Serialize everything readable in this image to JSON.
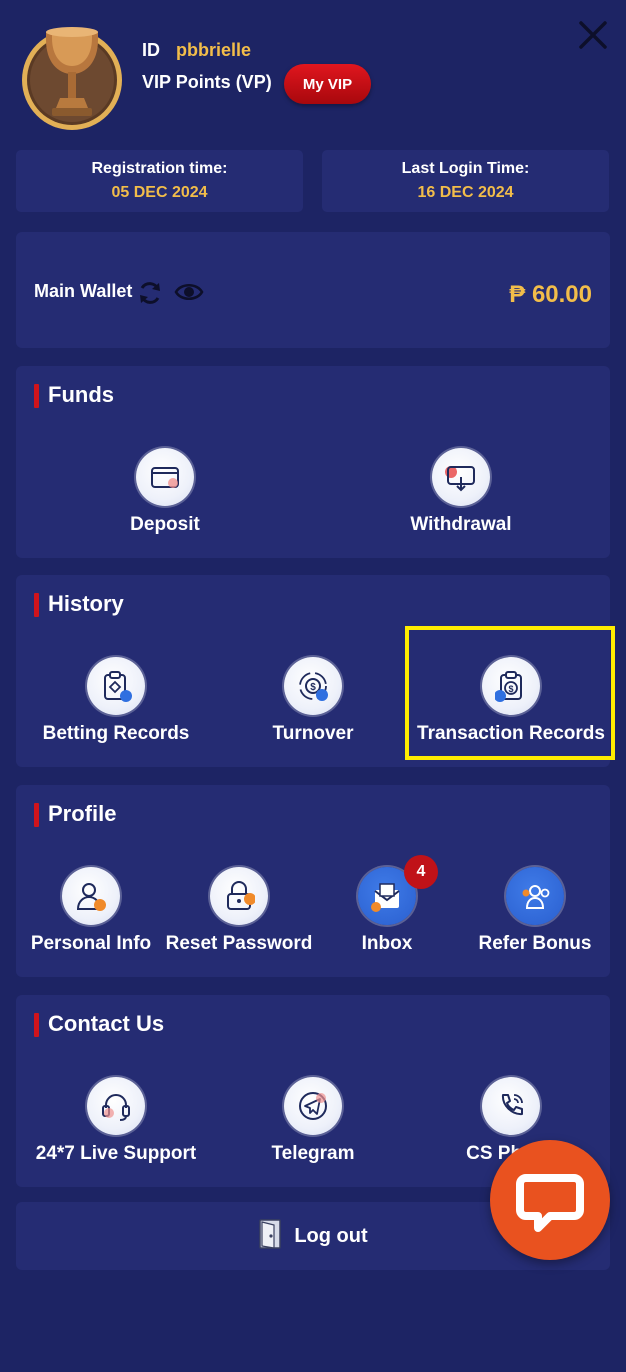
{
  "profile": {
    "id_label": "ID",
    "id_value": "pbbrielle",
    "vp_label": "VIP Points (VP)",
    "vip_button": "My VIP"
  },
  "times": {
    "registration_label": "Registration time:",
    "registration_value": "05 DEC 2024",
    "last_login_label": "Last Login Time:",
    "last_login_value": "16 DEC 2024"
  },
  "wallet": {
    "label": "Main Wallet",
    "amount": "₱ 60.00"
  },
  "funds": {
    "title": "Funds",
    "items": [
      {
        "label": "Deposit",
        "icon": "deposit-card-icon"
      },
      {
        "label": "Withdrawal",
        "icon": "withdrawal-card-icon"
      }
    ]
  },
  "history": {
    "title": "History",
    "items": [
      {
        "label": "Betting Records",
        "icon": "clipboard-icon"
      },
      {
        "label": "Turnover",
        "icon": "turnover-coin-icon"
      },
      {
        "label": "Transaction Records",
        "icon": "transaction-clipboard-icon"
      }
    ]
  },
  "profile_section": {
    "title": "Profile",
    "items": [
      {
        "label": "Personal Info",
        "icon": "user-icon"
      },
      {
        "label": "Reset Password",
        "icon": "lock-icon"
      },
      {
        "label": "Inbox",
        "icon": "envelope-icon",
        "badge": "4"
      },
      {
        "label": "Refer Bonus",
        "icon": "group-icon"
      }
    ]
  },
  "contact": {
    "title": "Contact Us",
    "items": [
      {
        "label": "24*7 Live Support",
        "icon": "headset-icon"
      },
      {
        "label": "Telegram",
        "icon": "telegram-icon"
      },
      {
        "label": "CS Phone",
        "icon": "phone-icon"
      }
    ]
  },
  "logout": {
    "label": "Log out"
  },
  "colors": {
    "background": "#1d2464",
    "card": "#252c73",
    "gold": "#f2bd4a",
    "accent_red": "#d0141c",
    "chat_orange": "#e9521f",
    "highlight": "#ffec00"
  }
}
